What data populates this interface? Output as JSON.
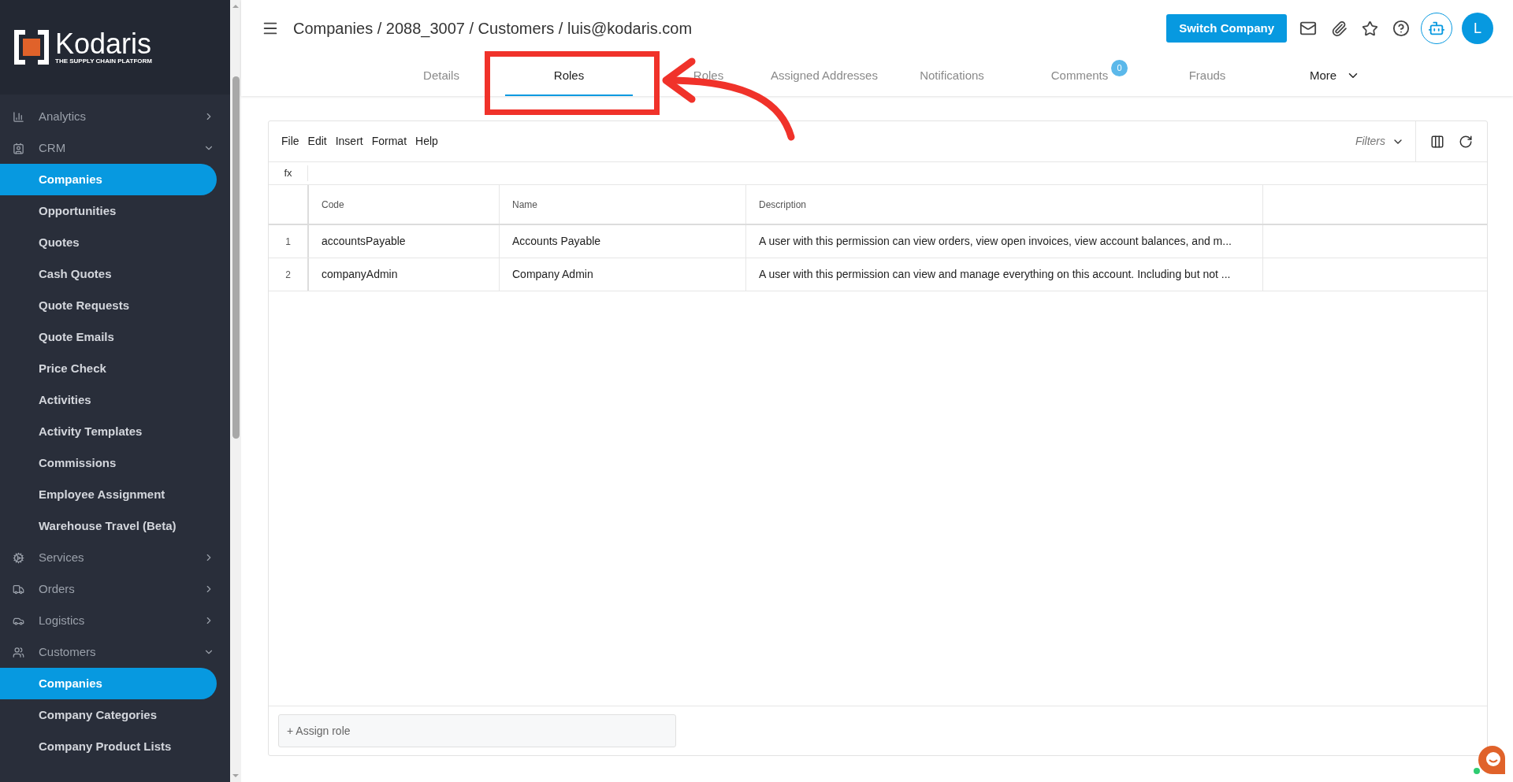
{
  "sidebar": {
    "logo": {
      "name": "Kodaris",
      "tagline": "THE SUPPLY CHAIN PLATFORM"
    },
    "items": [
      {
        "label": "Analytics",
        "expanded": false
      },
      {
        "label": "CRM",
        "expanded": true,
        "children": [
          {
            "label": "Companies",
            "selected": true
          },
          {
            "label": "Opportunities",
            "selected": false
          },
          {
            "label": "Quotes",
            "selected": false
          },
          {
            "label": "Cash Quotes",
            "selected": false
          },
          {
            "label": "Quote Requests",
            "selected": false
          },
          {
            "label": "Quote Emails",
            "selected": false
          },
          {
            "label": "Price Check",
            "selected": false
          },
          {
            "label": "Activities",
            "selected": false
          },
          {
            "label": "Activity Templates",
            "selected": false
          },
          {
            "label": "Commissions",
            "selected": false
          },
          {
            "label": "Employee Assignment",
            "selected": false
          },
          {
            "label": "Warehouse Travel (Beta)",
            "selected": false
          }
        ]
      },
      {
        "label": "Services",
        "expanded": false
      },
      {
        "label": "Orders",
        "expanded": false
      },
      {
        "label": "Logistics",
        "expanded": false
      },
      {
        "label": "Customers",
        "expanded": true,
        "children": [
          {
            "label": "Companies",
            "selected": true
          },
          {
            "label": "Company Categories",
            "selected": false
          },
          {
            "label": "Company Product Lists",
            "selected": false
          }
        ]
      }
    ]
  },
  "header": {
    "breadcrumb": "Companies / 2088_3007 / Customers / luis@kodaris.com",
    "switch_button": "Switch Company",
    "avatar": "L"
  },
  "tabs": [
    {
      "label": "Details",
      "selected": false
    },
    {
      "label": "Roles",
      "selected": true
    },
    {
      "label": "Roles",
      "selected": false,
      "kind": "covered"
    },
    {
      "label": "Assigned Addresses",
      "selected": false
    },
    {
      "label": "Notifications",
      "selected": false
    },
    {
      "label": "Comments",
      "selected": false,
      "badge": "0"
    },
    {
      "label": "Frauds",
      "selected": false
    },
    {
      "label": "More",
      "selected": false,
      "kind": "menu"
    }
  ],
  "grid": {
    "menu": [
      "File",
      "Edit",
      "Insert",
      "Format",
      "Help"
    ],
    "filters": "Filters",
    "formula_label": "fx",
    "columns": [
      "Code",
      "Name",
      "Description"
    ],
    "rows": [
      {
        "number": "1",
        "cells": [
          "accountsPayable",
          "Accounts Payable",
          "A user with this permission can view orders, view open invoices, view account balances, and m..."
        ]
      },
      {
        "number": "2",
        "cells": [
          "companyAdmin",
          "Company Admin",
          "A user with this permission can view and manage everything on this account. Including but not ..."
        ]
      }
    ],
    "assign_placeholder": "+ Assign role"
  }
}
